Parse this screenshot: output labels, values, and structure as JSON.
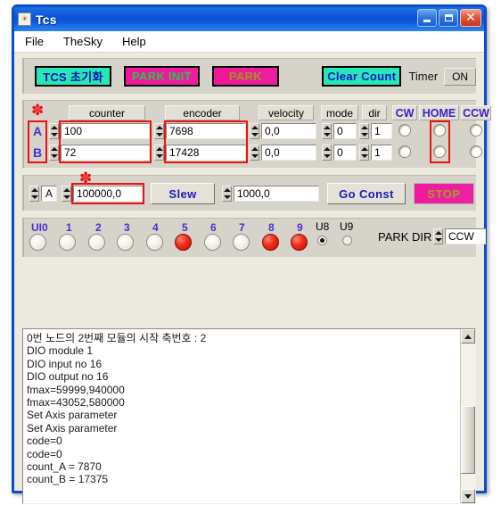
{
  "window": {
    "title": "Tcs",
    "icon": "app-icon",
    "controls": {
      "minimize": "minimize",
      "maximize": "maximize",
      "close": "close"
    }
  },
  "menu": {
    "items": [
      "File",
      "TheSky",
      "Help"
    ]
  },
  "toolbar": {
    "tcs_init_label": "TCS 초기화",
    "park_init_label": "PARK INIT",
    "park_label": "PARK",
    "clear_count_label": "Clear Count",
    "timer_label": "Timer",
    "timer_value": "ON"
  },
  "axis_panel": {
    "headers": {
      "counter": "counter",
      "encoder": "encoder",
      "velocity": "velocity",
      "mode": "mode",
      "dir": "dir",
      "cw": "CW",
      "home": "HOME",
      "ccw": "CCW"
    },
    "rows": [
      {
        "axis": "A",
        "counter": "100",
        "encoder": "7698",
        "velocity": "0,0",
        "mode": "0",
        "dir": "1"
      },
      {
        "axis": "B",
        "counter": "72",
        "encoder": "17428",
        "velocity": "0,0",
        "mode": "0",
        "dir": "1"
      }
    ]
  },
  "slew_panel": {
    "axis_value": "A",
    "slew_value": "100000,0",
    "slew_button": "Slew",
    "const_value": "1000,0",
    "go_const_button": "Go Const",
    "stop_button": "STOP"
  },
  "io_panel": {
    "labels": [
      "UI0",
      "1",
      "2",
      "3",
      "4",
      "5",
      "6",
      "7",
      "8",
      "9"
    ],
    "states": [
      false,
      false,
      false,
      false,
      false,
      true,
      false,
      false,
      true,
      true
    ],
    "u8_label": "U8",
    "u9_label": "U9",
    "u8_selected": true,
    "u9_selected": false,
    "park_dir_label": "PARK DIR",
    "park_dir_value": "CCW"
  },
  "log": {
    "lines": [
      "0번 노드의 2번째 모듈의 시작 축번호 : 2",
      "DIO module 1",
      "DIO input no 16",
      "DIO output no 16",
      "fmax=59999,940000",
      "fmax=43052,580000",
      "Set Axis parameter",
      "Set Axis parameter",
      "code=0",
      "code=0",
      "count_A = 7870",
      "count_B = 17375"
    ]
  },
  "colors": {
    "accent_cyan": "#27e7b4",
    "accent_magenta": "#f2159a",
    "highlight_red": "#ee1111",
    "title_blue": "#0a52d6",
    "label_purple": "#4a2fd0"
  }
}
